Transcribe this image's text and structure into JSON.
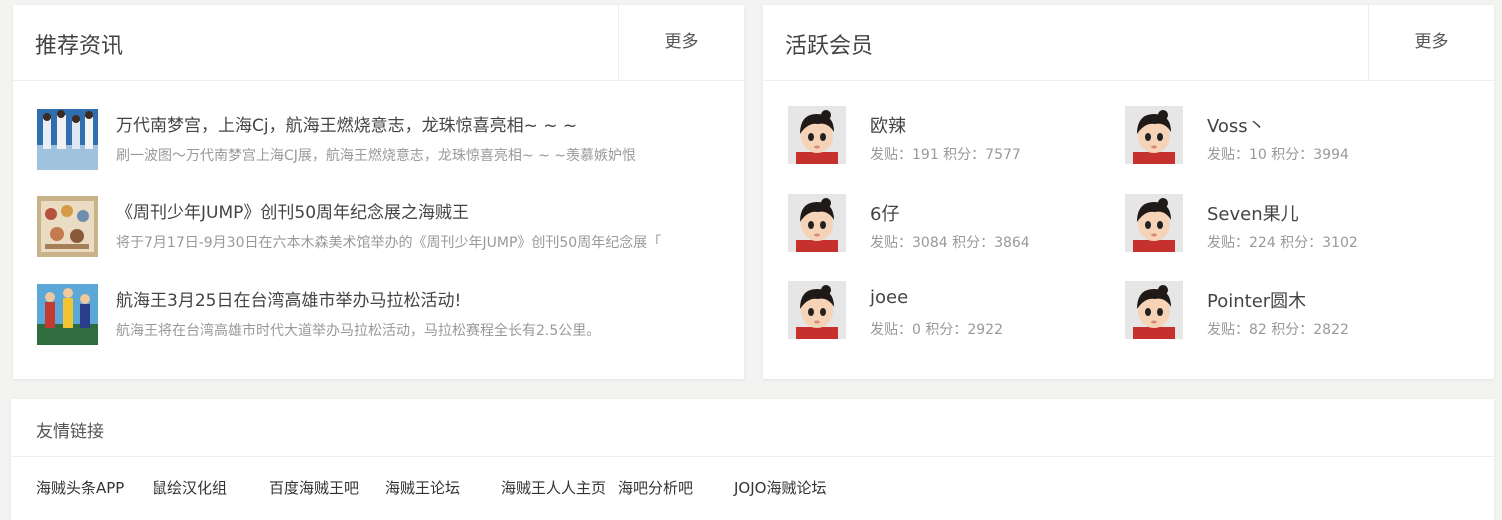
{
  "news": {
    "title": "推荐资讯",
    "more": "更多",
    "items": [
      {
        "title": "万代南梦宫，上海Cj，航海王燃烧意志，龙珠惊喜亮相~ ~ ~",
        "desc": "刷一波图～万代南梦宫上海CJ展，航海王燃烧意志，龙珠惊喜亮相~ ~ ~羡慕嫉妒恨"
      },
      {
        "title": "《周刊少年JUMP》创刊50周年纪念展之海贼王",
        "desc": "将于7月17日-9月30日在六本木森美术馆举办的《周刊少年JUMP》创刊50周年纪念展「"
      },
      {
        "title": "航海王3月25日在台湾高雄市举办马拉松活动!",
        "desc": "航海王将在台湾高雄市时代大道举办马拉松活动，马拉松赛程全长有2.5公里。"
      }
    ]
  },
  "members": {
    "title": "活跃会员",
    "more": "更多",
    "list": [
      {
        "name": "欧辣",
        "stats": "发贴：191 积分：7577"
      },
      {
        "name": "Voss丶",
        "stats": "发贴：10 积分：3994"
      },
      {
        "name": "6仔",
        "stats": "发贴：3084 积分：3864"
      },
      {
        "name": "Seven果儿",
        "stats": "发贴：224 积分：3102"
      },
      {
        "name": "joee",
        "stats": "发贴：0 积分：2922"
      },
      {
        "name": "Pointer圆木",
        "stats": "发贴：82 积分：2822"
      }
    ]
  },
  "friend_links": {
    "title": "友情链接",
    "items": [
      "海贼头条APP",
      "鼠绘汉化组",
      "百度海贼王吧",
      "海贼王论坛",
      "海贼王人人主页",
      "海吧分析吧",
      "JOJO海贼论坛"
    ]
  }
}
